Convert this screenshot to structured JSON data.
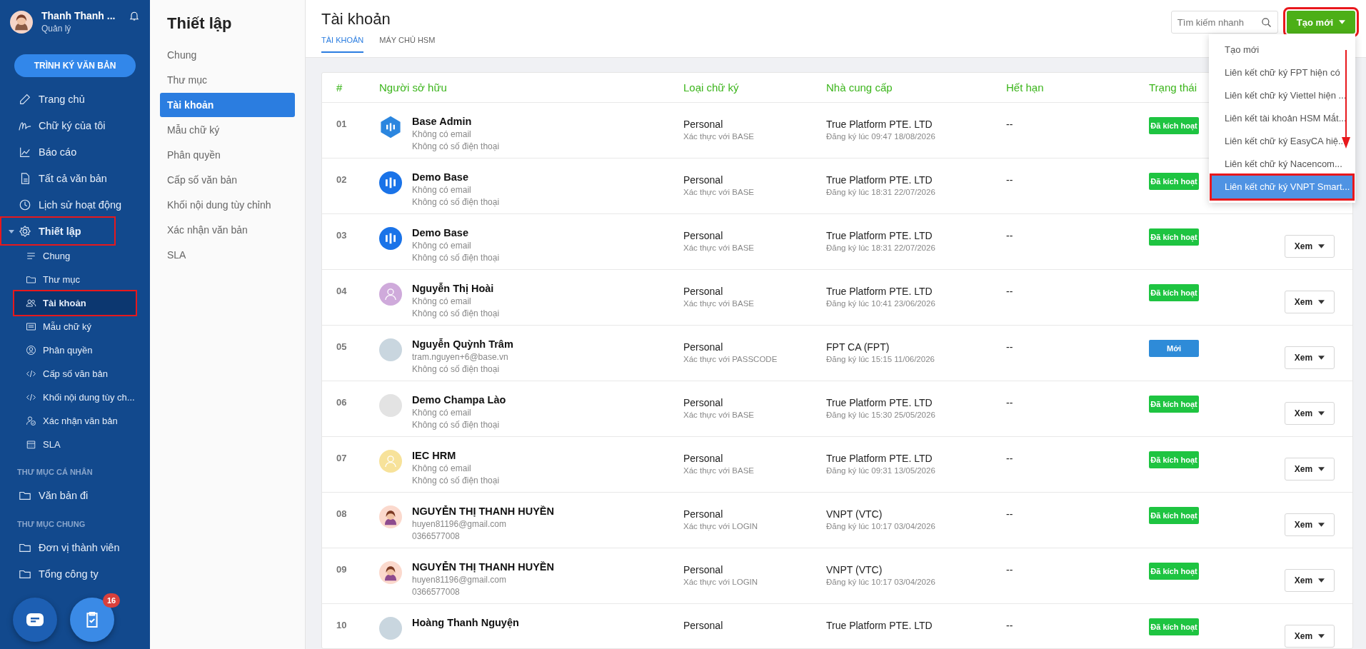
{
  "sidebar": {
    "user": {
      "name": "Thanh Thanh ...",
      "role": "Quản lý"
    },
    "primary_button": "TRÌNH KÝ VĂN BẢN",
    "items": [
      {
        "label": "Trang chủ",
        "selected": false,
        "highlighted": false
      },
      {
        "label": "Chữ ký của tôi",
        "selected": false,
        "highlighted": false
      },
      {
        "label": "Báo cáo",
        "selected": false,
        "highlighted": false
      },
      {
        "label": "Tất cả văn bản",
        "selected": false,
        "highlighted": false
      },
      {
        "label": "Lịch sử hoạt động",
        "selected": false,
        "highlighted": false
      },
      {
        "label": "Thiết lập",
        "selected": false,
        "highlighted": true,
        "expanded": true,
        "children": [
          {
            "label": "Chung",
            "selected": false,
            "highlighted": false
          },
          {
            "label": "Thư mục",
            "selected": false,
            "highlighted": false
          },
          {
            "label": "Tài khoản",
            "selected": true,
            "highlighted": true
          },
          {
            "label": "Mẫu chữ ký",
            "selected": false,
            "highlighted": false
          },
          {
            "label": "Phân quyền",
            "selected": false,
            "highlighted": false
          },
          {
            "label": "Cấp số văn bản",
            "selected": false,
            "highlighted": false
          },
          {
            "label": "Khối nội dung tùy ch...",
            "selected": false,
            "highlighted": false
          },
          {
            "label": "Xác nhận văn bản",
            "selected": false,
            "highlighted": false
          },
          {
            "label": "SLA",
            "selected": false,
            "highlighted": false
          }
        ]
      }
    ],
    "sections": [
      {
        "title": "THƯ MỤC CÁ NHÂN",
        "items": [
          {
            "label": "Văn bản đi"
          }
        ]
      },
      {
        "title": "THƯ MỤC CHUNG",
        "items": [
          {
            "label": "Đơn vị thành viên"
          },
          {
            "label": "Tổng công ty"
          }
        ]
      }
    ],
    "task_badge": "16"
  },
  "settings_menu": {
    "title": "Thiết lập",
    "items": [
      {
        "label": "Chung",
        "selected": false
      },
      {
        "label": "Thư mục",
        "selected": false
      },
      {
        "label": "Tài khoản",
        "selected": true
      },
      {
        "label": "Mẫu chữ ký",
        "selected": false
      },
      {
        "label": "Phân quyền",
        "selected": false
      },
      {
        "label": "Cấp số văn bản",
        "selected": false
      },
      {
        "label": "Khối nội dung tùy chỉnh",
        "selected": false
      },
      {
        "label": "Xác nhận văn bản",
        "selected": false
      },
      {
        "label": "SLA",
        "selected": false
      }
    ]
  },
  "header": {
    "title": "Tài khoản",
    "tabs": [
      {
        "label": "TÀI KHOẢN",
        "selected": true
      },
      {
        "label": "MÁY CHỦ HSM",
        "selected": false
      }
    ],
    "search": {
      "placeholder": "Tìm kiếm nhanh"
    },
    "create_button": {
      "label": "Tạo mới",
      "highlighted": true
    },
    "dropdown": [
      {
        "label": "Tạo mới",
        "selected": false,
        "highlighted": false
      },
      {
        "label": "Liên kết chữ ký FPT hiện có",
        "selected": false,
        "highlighted": false
      },
      {
        "label": "Liên kết chữ ký Viettel hiện ...",
        "selected": false,
        "highlighted": false
      },
      {
        "label": "Liên kết tài khoản HSM Mắt...",
        "selected": false,
        "highlighted": false
      },
      {
        "label": "Liên kết chữ ký EasyCA hiệ...",
        "selected": false,
        "highlighted": false
      },
      {
        "label": "Liên kết chữ ký Nacencom...",
        "selected": false,
        "highlighted": false
      },
      {
        "label": "Liên kết chữ ký VNPT Smart...",
        "selected": true,
        "highlighted": true
      }
    ]
  },
  "table": {
    "columns": [
      "#",
      "Người sở hữu",
      "Loại chữ ký",
      "Nhà cung cấp",
      "Hết hạn",
      "Trạng thái"
    ],
    "rows": [
      {
        "no": "01",
        "avatar": {
          "kind": "hex-logo"
        },
        "name": "Base Admin",
        "email": "Không có email",
        "phone": "Không có số điện thoại",
        "type": "Personal",
        "auth": "Xác thực với BASE",
        "provider": "True Platform PTE. LTD",
        "registered": "Đăng ký lúc 09:47 18/08/2026",
        "expiry": "--",
        "status": {
          "kind": "active",
          "label": "Đã kích hoạt"
        }
      },
      {
        "no": "02",
        "avatar": {
          "kind": "round-logo"
        },
        "name": "Demo Base",
        "email": "Không có email",
        "phone": "Không có số điện thoại",
        "type": "Personal",
        "auth": "Xác thực với BASE",
        "provider": "True Platform PTE. LTD",
        "registered": "Đăng ký lúc 18:31 22/07/2026",
        "expiry": "--",
        "status": {
          "kind": "active",
          "label": "Đã kích hoạt"
        }
      },
      {
        "no": "03",
        "avatar": {
          "kind": "round-logo"
        },
        "name": "Demo Base",
        "email": "Không có email",
        "phone": "Không có số điện thoại",
        "type": "Personal",
        "auth": "Xác thực với BASE",
        "provider": "True Platform PTE. LTD",
        "registered": "Đăng ký lúc 18:31 22/07/2026",
        "expiry": "--",
        "status": {
          "kind": "active",
          "label": "Đã kích hoạt"
        },
        "action": "Xem"
      },
      {
        "no": "04",
        "avatar": {
          "kind": "silhouette",
          "color": "#cfaadb"
        },
        "name": "Nguyễn Thị Hoài",
        "email": "Không có email",
        "phone": "Không có số điện thoại",
        "type": "Personal",
        "auth": "Xác thực với BASE",
        "provider": "True Platform PTE. LTD",
        "registered": "Đăng ký lúc 10:41 23/06/2026",
        "expiry": "--",
        "status": {
          "kind": "active",
          "label": "Đã kích hoạt"
        },
        "action": "Xem"
      },
      {
        "no": "05",
        "avatar": {
          "kind": "photo"
        },
        "name": "Nguyễn Quỳnh Trâm",
        "email": "tram.nguyen+6@base.vn",
        "phone": "Không có số điện thoại",
        "type": "Personal",
        "auth": "Xác thực với PASSCODE",
        "provider": "FPT CA (FPT)",
        "registered": "Đăng ký lúc 15:15 11/06/2026",
        "expiry": "--",
        "status": {
          "kind": "new",
          "label": "Mới"
        },
        "action": "Xem"
      },
      {
        "no": "06",
        "avatar": {
          "kind": "blank"
        },
        "name": "Demo Champa Lào",
        "email": "Không có email",
        "phone": "Không có số điện thoại",
        "type": "Personal",
        "auth": "Xác thực với BASE",
        "provider": "True Platform PTE. LTD",
        "registered": "Đăng ký lúc 15:30 25/05/2026",
        "expiry": "--",
        "status": {
          "kind": "active",
          "label": "Đã kích hoạt"
        },
        "action": "Xem"
      },
      {
        "no": "07",
        "avatar": {
          "kind": "silhouette",
          "color": "#f7e29a"
        },
        "name": "IEC HRM",
        "email": "Không có email",
        "phone": "Không có số điện thoại",
        "type": "Personal",
        "auth": "Xác thực với BASE",
        "provider": "True Platform PTE. LTD",
        "registered": "Đăng ký lúc 09:31 13/05/2026",
        "expiry": "--",
        "status": {
          "kind": "active",
          "label": "Đã kích hoạt"
        },
        "action": "Xem"
      },
      {
        "no": "08",
        "avatar": {
          "kind": "cartoon"
        },
        "name": "NGUYỄN THỊ THANH HUYỀN",
        "email": "huyen81196@gmail.com",
        "phone": "0366577008",
        "type": "Personal",
        "auth": "Xác thực với LOGIN",
        "provider": "VNPT (VTC)",
        "registered": "Đăng ký lúc 10:17 03/04/2026",
        "expiry": "--",
        "status": {
          "kind": "active",
          "label": "Đã kích hoạt"
        },
        "action": "Xem"
      },
      {
        "no": "09",
        "avatar": {
          "kind": "cartoon"
        },
        "name": "NGUYỄN THỊ THANH HUYỀN",
        "email": "huyen81196@gmail.com",
        "phone": "0366577008",
        "type": "Personal",
        "auth": "Xác thực với LOGIN",
        "provider": "VNPT (VTC)",
        "registered": "Đăng ký lúc 10:17 03/04/2026",
        "expiry": "--",
        "status": {
          "kind": "active",
          "label": "Đã kích hoạt"
        },
        "action": "Xem"
      },
      {
        "no": "10",
        "avatar": {
          "kind": "photo"
        },
        "name": "Hoàng Thanh Nguyện",
        "type": "Personal",
        "provider": "True Platform PTE. LTD",
        "expiry": "--",
        "status": {
          "kind": "active",
          "label": "Đã kích hoạt"
        },
        "action": "Xem"
      }
    ]
  }
}
